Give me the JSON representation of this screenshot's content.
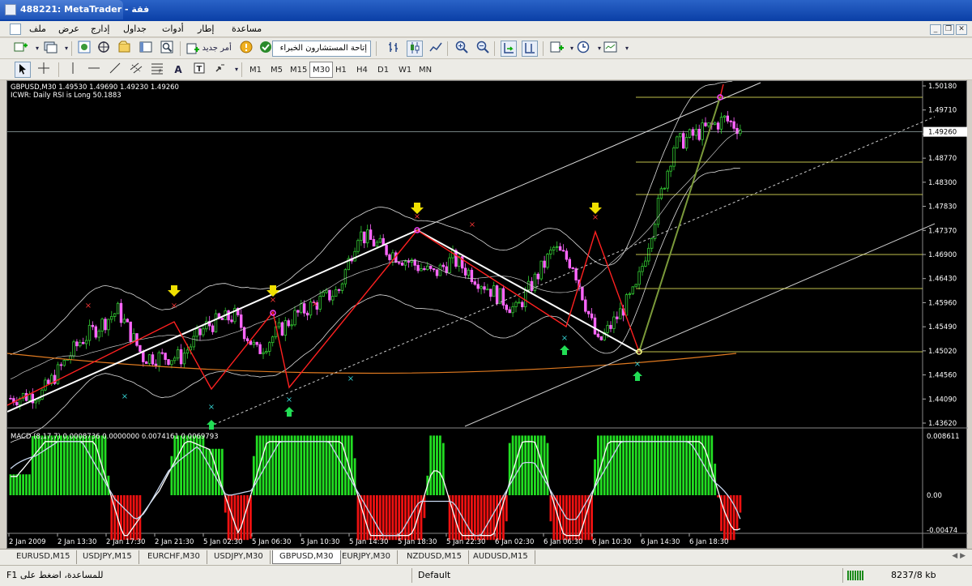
{
  "window": {
    "title": "488221: MetaTrader - فقة"
  },
  "menu": [
    "ملف",
    "عرض",
    "إدارج",
    "جداول",
    "أدوات",
    "إطار",
    "مساعدة"
  ],
  "toolbar": {
    "new_order_label": "أمر جديد",
    "expert_combo": "إتاحة المستشارون الخبراء"
  },
  "timeframes": [
    "M1",
    "M5",
    "M15",
    "M30",
    "H1",
    "H4",
    "D1",
    "W1",
    "MN"
  ],
  "active_timeframe": "M30",
  "chart": {
    "header_line1": "GBPUSD,M30  1.49530 1.49690 1.49230 1.49260",
    "header_line2": "ICWR: Daily RSI is Long 50.1883",
    "price_axis": [
      "1.50180",
      "1.49710",
      "1.49260",
      "1.48770",
      "1.48300",
      "1.47830",
      "1.47370",
      "1.46900",
      "1.46430",
      "1.45960",
      "1.45490",
      "1.45020",
      "1.44560",
      "1.44090",
      "1.43620"
    ],
    "current_price": "1.49260",
    "time_axis": [
      "2 Jan 2009",
      "2 Jan 13:30",
      "2 Jan 17:30",
      "2 Jan 21:30",
      "5 Jan 02:30",
      "5 Jan 06:30",
      "5 Jan 10:30",
      "5 Jan 14:30",
      "5 Jan 18:30",
      "5 Jan 22:30",
      "6 Jan 02:30",
      "6 Jan 06:30",
      "6 Jan 10:30",
      "6 Jan 14:30",
      "6 Jan 18:30"
    ],
    "macd_label": "MACD  (8,17,7) 0.0008736 0.0000000 0.0074161 0.0069793",
    "macd_axis": [
      "0.008611",
      "0.00",
      "-0.00474"
    ],
    "colors": {
      "bull": "#ffffff",
      "bear": "#ff66ff",
      "zigzag": "#ff2020",
      "trend": "#ffffff",
      "fib": "#ffff66",
      "macd_up": "#22dd22",
      "macd_down": "#ee1111"
    }
  },
  "symbol_tabs": [
    "EURUSD,M15",
    "USDJPY,M15",
    "EURCHF,M30",
    "USDJPY,M30",
    "GBPUSD,M30",
    "EURJPY,M30",
    "NZDUSD,M15",
    "AUDUSD,M15"
  ],
  "active_symbol_tab": "GBPUSD,M30",
  "status": {
    "help": "للمساعدة، اضغط على F1",
    "profile": "Default",
    "traffic": "8237/8 kb"
  }
}
